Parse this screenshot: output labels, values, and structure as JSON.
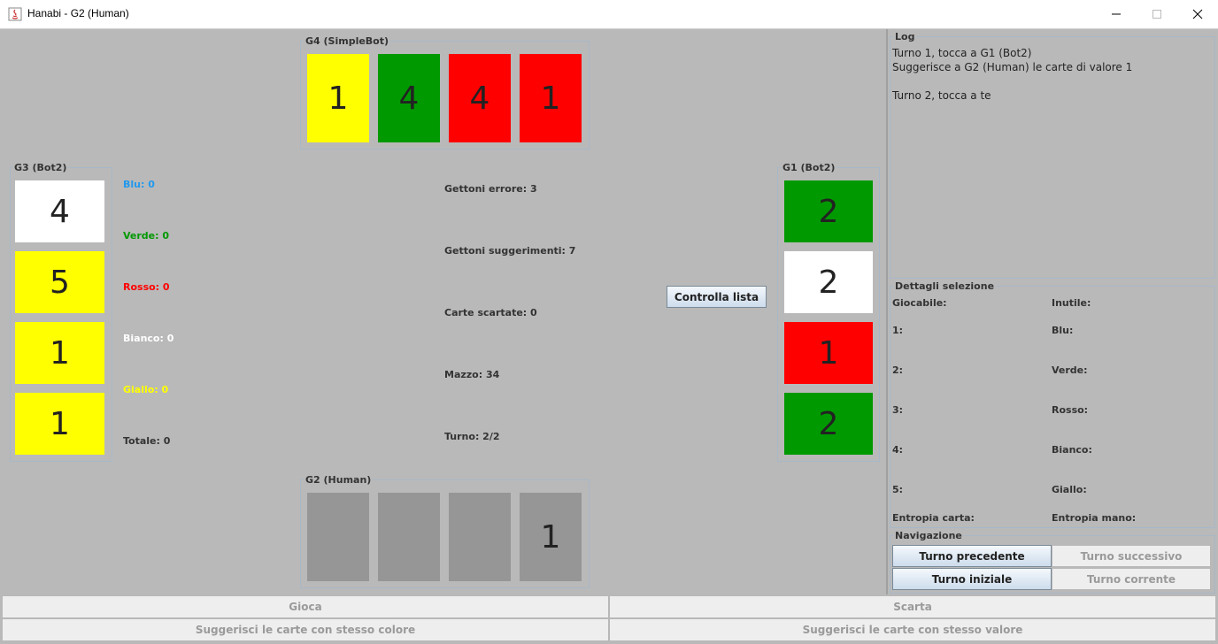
{
  "window": {
    "title": "Hanabi - G2 (Human)"
  },
  "colors": {
    "blue": "#0099ff",
    "green": "#009900",
    "red": "#ff0000",
    "white": "#ffffff",
    "yellow": "#ffff00",
    "grey": "#969696"
  },
  "players": {
    "g4": {
      "label": "G4 (SimpleBot)",
      "cards": [
        {
          "value": "1",
          "color": "yellow"
        },
        {
          "value": "4",
          "color": "green"
        },
        {
          "value": "4",
          "color": "red"
        },
        {
          "value": "1",
          "color": "red"
        }
      ]
    },
    "g3": {
      "label": "G3 (Bot2)",
      "cards": [
        {
          "value": "4",
          "color": "white"
        },
        {
          "value": "5",
          "color": "yellow"
        },
        {
          "value": "1",
          "color": "yellow"
        },
        {
          "value": "1",
          "color": "yellow"
        }
      ]
    },
    "g1": {
      "label": "G1 (Bot2)",
      "cards": [
        {
          "value": "2",
          "color": "green"
        },
        {
          "value": "2",
          "color": "white"
        },
        {
          "value": "1",
          "color": "red"
        },
        {
          "value": "2",
          "color": "green"
        }
      ]
    },
    "g2": {
      "label": "G2 (Human)",
      "cards": [
        {
          "value": "",
          "color": "grey"
        },
        {
          "value": "",
          "color": "grey"
        },
        {
          "value": "",
          "color": "grey"
        },
        {
          "value": "1",
          "color": "grey"
        }
      ]
    }
  },
  "fireworks": {
    "blu": "Blu: 0",
    "verde": "Verde: 0",
    "rosso": "Rosso: 0",
    "bianco": "Bianco: 0",
    "giallo": "Giallo: 0",
    "totale": "Totale: 0"
  },
  "status": {
    "errori": "Gettoni errore: 3",
    "suggerimenti": "Gettoni suggerimenti: 7",
    "scartate": "Carte scartate: 0",
    "mazzo": "Mazzo: 34",
    "turno": "Turno: 2/2"
  },
  "controlla_label": "Controlla lista",
  "log": {
    "title": "Log",
    "lines": [
      "Turno 1, tocca a G1 (Bot2)",
      "Suggerisce a G2 (Human) le carte di valore 1",
      "",
      "Turno 2, tocca a te"
    ]
  },
  "details": {
    "title": "Dettagli selezione",
    "left": [
      "Giocabile:",
      "1:",
      "2:",
      "3:",
      "4:",
      "5:",
      "Entropia carta:"
    ],
    "right": [
      "Inutile:",
      "Blu:",
      "Verde:",
      "Rosso:",
      "Bianco:",
      "Giallo:",
      "Entropia mano:"
    ]
  },
  "navigation": {
    "title": "Navigazione",
    "prev": "Turno precedente",
    "next": "Turno successivo",
    "first": "Turno iniziale",
    "current": "Turno corrente"
  },
  "actions": {
    "play": "Gioca",
    "discard": "Scarta",
    "hint_color": "Suggerisci le carte con stesso colore",
    "hint_value": "Suggerisci le carte con stesso valore"
  }
}
